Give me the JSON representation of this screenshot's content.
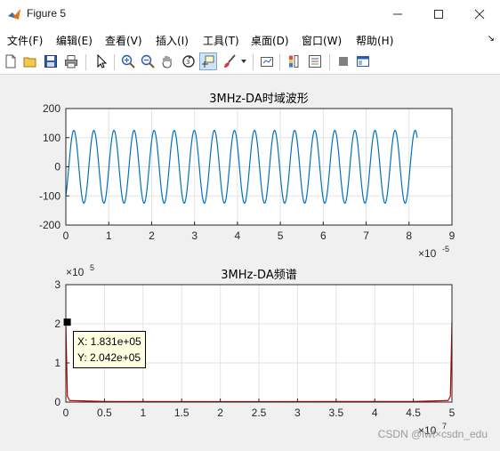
{
  "window": {
    "title": "Figure 5",
    "minimize_icon": "minimize-icon",
    "maximize_icon": "maximize-icon",
    "close_icon": "close-icon"
  },
  "menu": {
    "items": [
      "文件(F)",
      "编辑(E)",
      "查看(V)",
      "插入(I)",
      "工具(T)",
      "桌面(D)",
      "窗口(W)",
      "帮助(H)"
    ],
    "overflow_arrow": "↘"
  },
  "toolbar": {
    "buttons": [
      "new-figure-icon",
      "open-icon",
      "save-icon",
      "print-icon",
      "select-arrow-icon",
      "zoom-in-icon",
      "zoom-out-icon",
      "pan-hand-icon",
      "rotate-3d-icon",
      "data-cursor-icon",
      "brush-icon",
      "link-plot-icon",
      "colorbar-icon",
      "legend-icon",
      "hide-plot-tools-icon",
      "show-plot-tools-icon"
    ]
  },
  "chart_data": [
    {
      "type": "line",
      "title": "3MHz-DA时域波形",
      "xlabel": "",
      "ylabel": "",
      "x_exponent_label": "×10",
      "x_exponent": "-5",
      "xlim": [
        0,
        9
      ],
      "ylim": [
        -200,
        200
      ],
      "x_ticks": [
        "0",
        "1",
        "2",
        "3",
        "4",
        "5",
        "6",
        "7",
        "8",
        "9"
      ],
      "y_ticks": [
        "200",
        "100",
        "0",
        "-100",
        "-200"
      ],
      "y_tick_values": [
        200,
        100,
        0,
        -100,
        -200
      ],
      "series": [
        {
          "color": "#0072bd",
          "amplitude": 125,
          "x_start": 0,
          "x_end": 8.19,
          "cycles": 17.5,
          "start_value": -100
        }
      ],
      "grid": true
    },
    {
      "type": "line",
      "title": "3MHz-DA频谱",
      "xlabel": "",
      "ylabel": "",
      "x_exponent_label": "×10",
      "x_exponent": "7",
      "y_exponent_label": "×10",
      "y_exponent": "5",
      "xlim": [
        0,
        5
      ],
      "ylim": [
        0,
        3
      ],
      "x_ticks": [
        "0",
        "0.5",
        "1",
        "1.5",
        "2",
        "2.5",
        "3",
        "3.5",
        "4",
        "4.5",
        "5"
      ],
      "y_ticks": [
        "3",
        "2",
        "1",
        "0"
      ],
      "y_tick_values": [
        3,
        2,
        1,
        0
      ],
      "series": [
        {
          "color": "#c00000",
          "points": [
            [
              0,
              2.042
            ],
            [
              0.02,
              0.15
            ],
            [
              0.05,
              0.04
            ],
            [
              0.5,
              0.015
            ],
            [
              2.5,
              0.012
            ],
            [
              4.5,
              0.015
            ],
            [
              4.95,
              0.04
            ],
            [
              4.98,
              0.15
            ],
            [
              5.0,
              2.042
            ]
          ]
        }
      ],
      "grid": true,
      "datatip": {
        "x_label": "X: 1.831e+05",
        "y_label": "Y: 2.042e+05",
        "x_value": 0.01831,
        "y_value": 2.042
      }
    }
  ],
  "watermark": "CSDN @lwt×csdn_edu"
}
